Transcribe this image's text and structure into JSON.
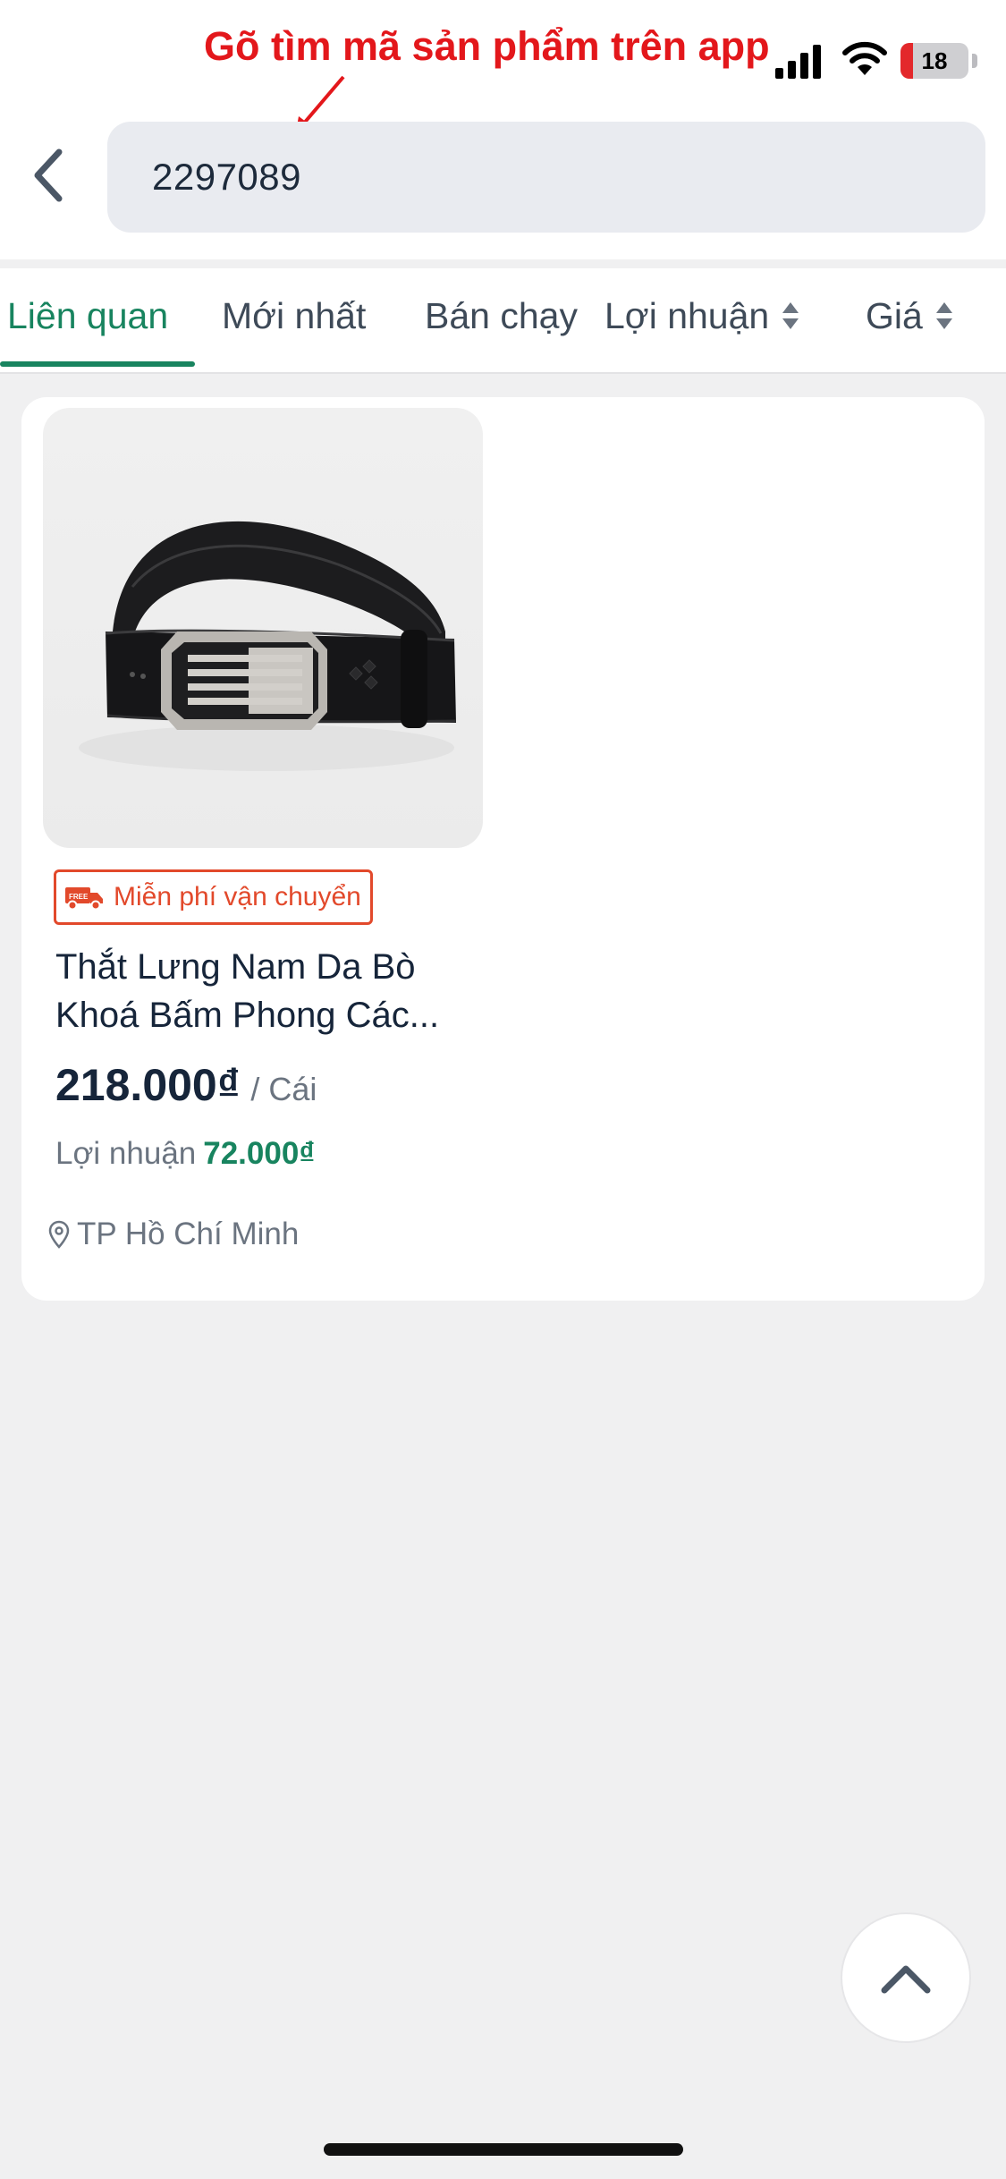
{
  "annotation": {
    "text": "Gõ tìm mã sản phẩm trên app",
    "color": "#e3171b"
  },
  "status_bar": {
    "battery_level": "18",
    "icons": [
      "signal-icon",
      "wifi-icon",
      "battery-icon"
    ]
  },
  "search": {
    "value": "2297089",
    "back_icon": "chevron-left-icon"
  },
  "tabs": [
    {
      "label": "Liên quan",
      "active": true
    },
    {
      "label": "Mới nhất",
      "active": false
    },
    {
      "label": "Bán chạy",
      "active": false
    },
    {
      "label": "Lợi nhuận",
      "active": false,
      "sortable": true
    },
    {
      "label": "Giá",
      "active": false,
      "sortable": true
    }
  ],
  "product": {
    "badge": "Miễn phí vận chuyển",
    "badge_icon_text": "FREE",
    "name_line1": "Thắt Lưng Nam Da Bò",
    "name_line2": "Khoá Bấm Phong Các...",
    "price": "218.000₫",
    "unit": "/ Cái",
    "profit_label": "Lợi nhuận",
    "profit_value": "72.000₫",
    "location": "TP Hồ Chí Minh"
  },
  "colors": {
    "accent": "#18845f",
    "badge": "#e2492b",
    "text": "#16253a"
  }
}
